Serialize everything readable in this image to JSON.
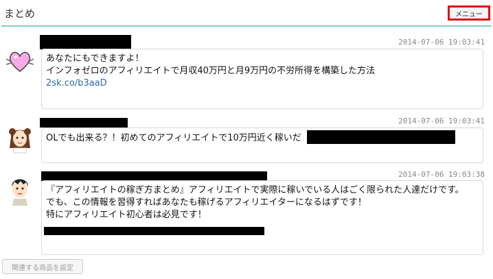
{
  "header": {
    "title": "まとめ",
    "menu_label": "メニュー"
  },
  "posts": [
    {
      "timestamp": "2014-07-06 19:03:41",
      "avatar_icon": "heart-icon",
      "lines": [
        "あなたにもできますよ！",
        "インフォゼロのアフィリエイトで月収40万円と月9万円の不労所得を構築した方法"
      ],
      "link": "2sk.co/b3aaD"
    },
    {
      "timestamp": "2014-07-06 19:03:41",
      "avatar_icon": "girl-avatar-icon",
      "lines": [
        "OLでも出来る？！初めてのアフィリエイトで10万円近く稼いだ"
      ]
    },
    {
      "timestamp": "2014-07-06 19:03:38",
      "avatar_icon": "man-avatar-icon",
      "lines": [
        "『アフィリエイトの稼ぎ方まとめ』アフィリエイトで実際に稼いでいる人はごく限られた人達だけです。",
        "でも、この情報を習得すればあなたも稼げるアフィリエイターになるはずです！",
        "特にアフィリエイト初心者は必見です！"
      ]
    }
  ],
  "footer": {
    "product_button_label": "関連する商品を設定"
  },
  "colors": {
    "accent_line": "#7fcbbc",
    "menu_border": "#e01010",
    "link": "#2b6aa8"
  }
}
